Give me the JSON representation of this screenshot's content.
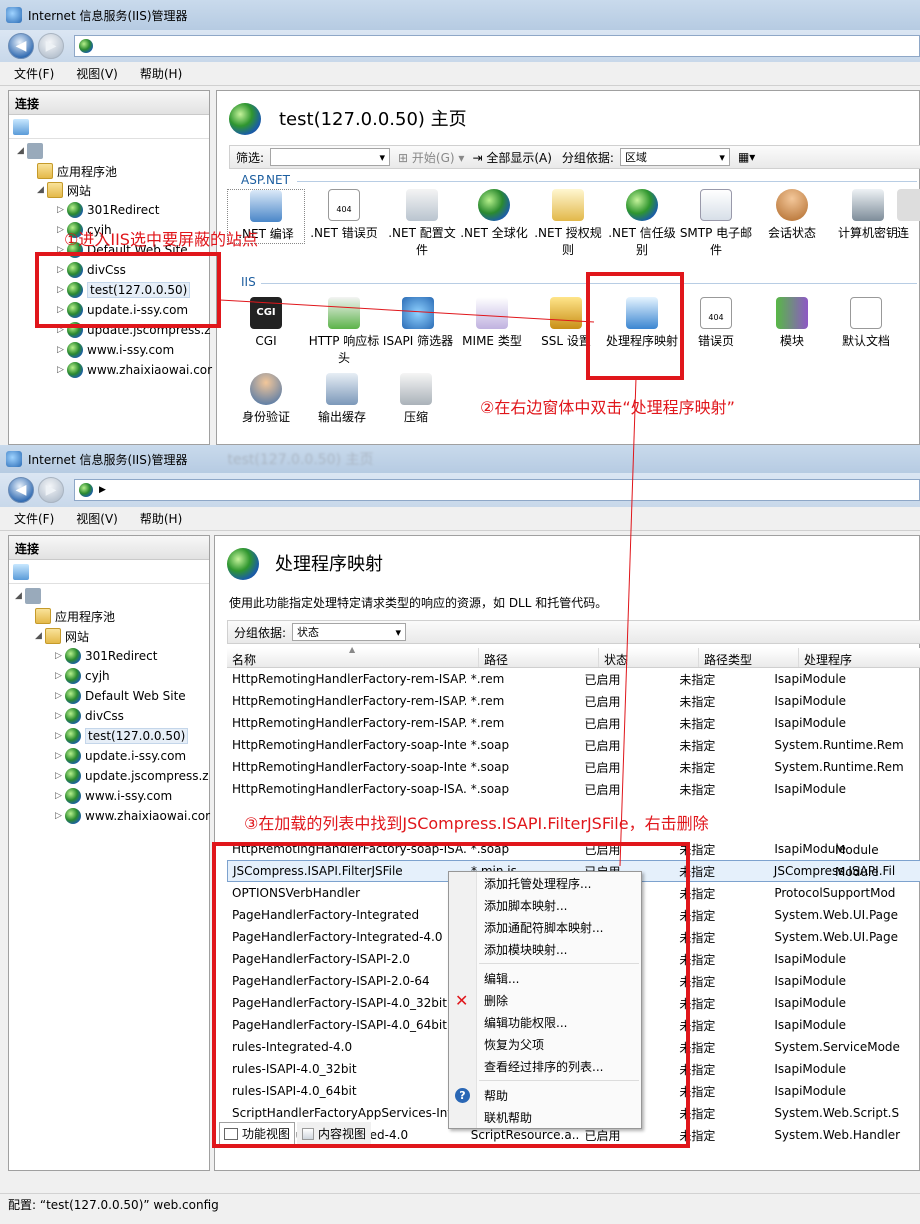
{
  "window1": {
    "title": "Internet 信息服务(IIS)管理器",
    "menu": [
      "文件(F)",
      "视图(V)",
      "帮助(H)"
    ],
    "connections_label": "连接",
    "tree": {
      "app_pools": "应用程序池",
      "sites": "网站",
      "items": [
        "301Redirect",
        "cyjh",
        "Default Web Site",
        "divCss",
        "test(127.0.0.50)",
        "update.i-ssy.com",
        "update.jscompress.z",
        "www.i-ssy.com",
        "www.zhaixiaowai.cor"
      ]
    },
    "page_title": "test(127.0.0.50) 主页",
    "filter_label": "筛选:",
    "start_label": "开始(G)",
    "show_all_label": "全部显示(A)",
    "group_label": "分组依据:",
    "group_value": "区域",
    "sections": {
      "aspnet": "ASP.NET",
      "iis": "IIS"
    },
    "aspnet_features": [
      ".NET 编译",
      ".NET 错误页",
      ".NET 配置文件",
      ".NET 全球化",
      ".NET 授权规则",
      ".NET 信任级别",
      "SMTP 电子邮件",
      "会话状态",
      "计算机密钥",
      "连"
    ],
    "iis_features": [
      "CGI",
      "HTTP 响应标头",
      "ISAPI 筛选器",
      "MIME 类型",
      "SSL 设置",
      "处理程序映射",
      "错误页",
      "模块",
      "默认文档"
    ],
    "iis_features2": [
      "身份验证",
      "输出缓存",
      "压缩"
    ]
  },
  "window2": {
    "title": "Internet 信息服务(IIS)管理器",
    "bg_title": "test(127.0.0.50) 主页",
    "menu": [
      "文件(F)",
      "视图(V)",
      "帮助(H)"
    ],
    "connections_label": "连接",
    "tree": {
      "app_pools": "应用程序池",
      "sites": "网站",
      "items": [
        "301Redirect",
        "cyjh",
        "Default Web Site",
        "divCss",
        "test(127.0.0.50)",
        "update.i-ssy.com",
        "update.jscompress.z",
        "www.i-ssy.com",
        "www.zhaixiaowai.cor"
      ]
    },
    "page_title": "处理程序映射",
    "description": "使用此功能指定处理特定请求类型的响应的资源，如 DLL 和托管代码。",
    "group_label": "分组依据:",
    "group_value": "状态",
    "columns": [
      "名称",
      "路径",
      "状态",
      "路径类型",
      "处理程序"
    ],
    "rows_top": [
      [
        "HttpRemotingHandlerFactory-rem-ISAP...",
        "*.rem",
        "已启用",
        "未指定",
        "IsapiModule"
      ],
      [
        "HttpRemotingHandlerFactory-rem-ISAP...",
        "*.rem",
        "已启用",
        "未指定",
        "IsapiModule"
      ],
      [
        "HttpRemotingHandlerFactory-rem-ISAP...",
        "*.rem",
        "已启用",
        "未指定",
        "IsapiModule"
      ],
      [
        "HttpRemotingHandlerFactory-soap-Inte...",
        "*.soap",
        "已启用",
        "未指定",
        "System.Runtime.Rem"
      ],
      [
        "HttpRemotingHandlerFactory-soap-Inte...",
        "*.soap",
        "已启用",
        "未指定",
        "System.Runtime.Rem"
      ],
      [
        "HttpRemotingHandlerFactory-soap-ISA...",
        "*.soap",
        "已启用",
        "未指定",
        "IsapiModule"
      ]
    ],
    "hidden_handlers": [
      "Module",
      "Module"
    ],
    "rows_bottom": [
      [
        "HttpRemotingHandlerFactory-soap-ISA...",
        "*.soap",
        "已启用",
        "未指定",
        "IsapiModule"
      ],
      [
        "JSCompress.ISAPI.FilterJSFile",
        "*.min.js",
        "已启用",
        "未指定",
        "JSCompress.ISAPI.Fil"
      ],
      [
        "OPTIONSVerbHandler",
        "",
        "",
        "未指定",
        "ProtocolSupportMod"
      ],
      [
        "PageHandlerFactory-Integrated",
        "",
        "",
        "未指定",
        "System.Web.UI.Page"
      ],
      [
        "PageHandlerFactory-Integrated-4.0",
        "",
        "",
        "未指定",
        "System.Web.UI.Page"
      ],
      [
        "PageHandlerFactory-ISAPI-2.0",
        "",
        "",
        "未指定",
        "IsapiModule"
      ],
      [
        "PageHandlerFactory-ISAPI-2.0-64",
        "",
        "",
        "未指定",
        "IsapiModule"
      ],
      [
        "PageHandlerFactory-ISAPI-4.0_32bit",
        "",
        "",
        "未指定",
        "IsapiModule"
      ],
      [
        "PageHandlerFactory-ISAPI-4.0_64bit",
        "",
        "",
        "未指定",
        "IsapiModule"
      ],
      [
        "rules-Integrated-4.0",
        "",
        "",
        "未指定",
        "System.ServiceMode"
      ],
      [
        "rules-ISAPI-4.0_32bit",
        "",
        "",
        "未指定",
        "IsapiModule"
      ],
      [
        "rules-ISAPI-4.0_64bit",
        "",
        "",
        "未指定",
        "IsapiModule"
      ],
      [
        "ScriptHandlerFactoryAppServices-Inte",
        "",
        "",
        "未指定",
        "System.Web.Script.S"
      ],
      [
        "ScriptResourceIntegrated-4.0",
        "ScriptResource.a...",
        "已启用",
        "未指定",
        "System.Web.Handler"
      ]
    ],
    "context_menu": {
      "group1": [
        "添加托管处理程序...",
        "添加脚本映射...",
        "添加通配符脚本映射...",
        "添加模块映射..."
      ],
      "group2": [
        "编辑...",
        "删除",
        "编辑功能权限...",
        "恢复为父项",
        "查看经过排序的列表..."
      ],
      "group3": [
        "帮助",
        "联机帮助"
      ]
    },
    "bottom_tabs": [
      "功能视图",
      "内容视图"
    ],
    "status": "配置: “test(127.0.0.50)” web.config"
  },
  "annotations": {
    "step1": "①进入IIS选中要屏蔽的站点",
    "step2": "②在右边窗体中双击“处理程序映射”",
    "step3": "③在加载的列表中找到JSCompress.ISAPI.FilterJSFile，右击删除"
  },
  "colors": {
    "annotation_red": "#e0161b",
    "section_blue": "#1e5fa0"
  }
}
